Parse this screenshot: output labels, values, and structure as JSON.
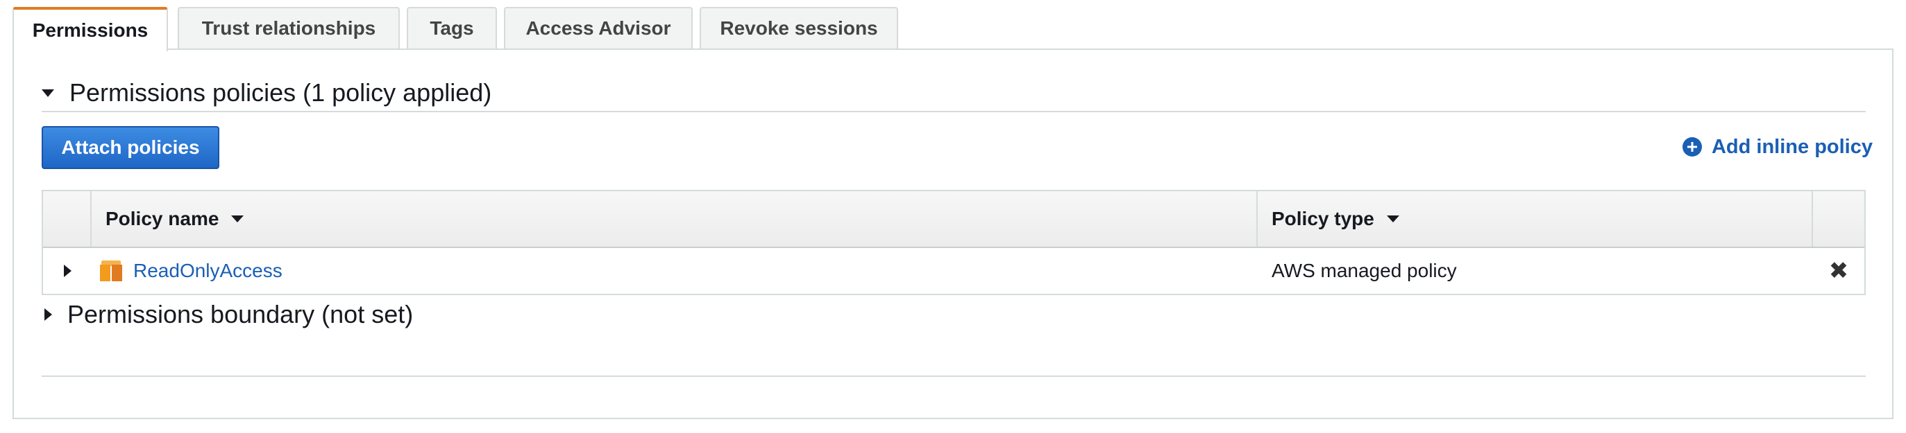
{
  "tabs": [
    {
      "label": "Permissions",
      "active": true
    },
    {
      "label": "Trust relationships",
      "active": false
    },
    {
      "label": "Tags",
      "active": false
    },
    {
      "label": "Access Advisor",
      "active": false
    },
    {
      "label": "Revoke sessions",
      "active": false
    }
  ],
  "permissions_policies": {
    "title": "Permissions policies (1 policy applied)",
    "expanded": true,
    "attach_button_label": "Attach policies",
    "add_inline_label": "Add inline policy",
    "table": {
      "columns": [
        "Policy name",
        "Policy type"
      ],
      "rows": [
        {
          "name": "ReadOnlyAccess",
          "type": "AWS managed policy",
          "icon": "aws-managed-policy-box-icon",
          "remove_icon": "close-icon"
        }
      ]
    }
  },
  "permissions_boundary": {
    "title": "Permissions boundary (not set)",
    "expanded": false
  },
  "colors": {
    "accent_tab": "#e07b20",
    "primary_button": "#1f66c6",
    "link": "#1a5fb4",
    "border": "#d5dbdb"
  }
}
